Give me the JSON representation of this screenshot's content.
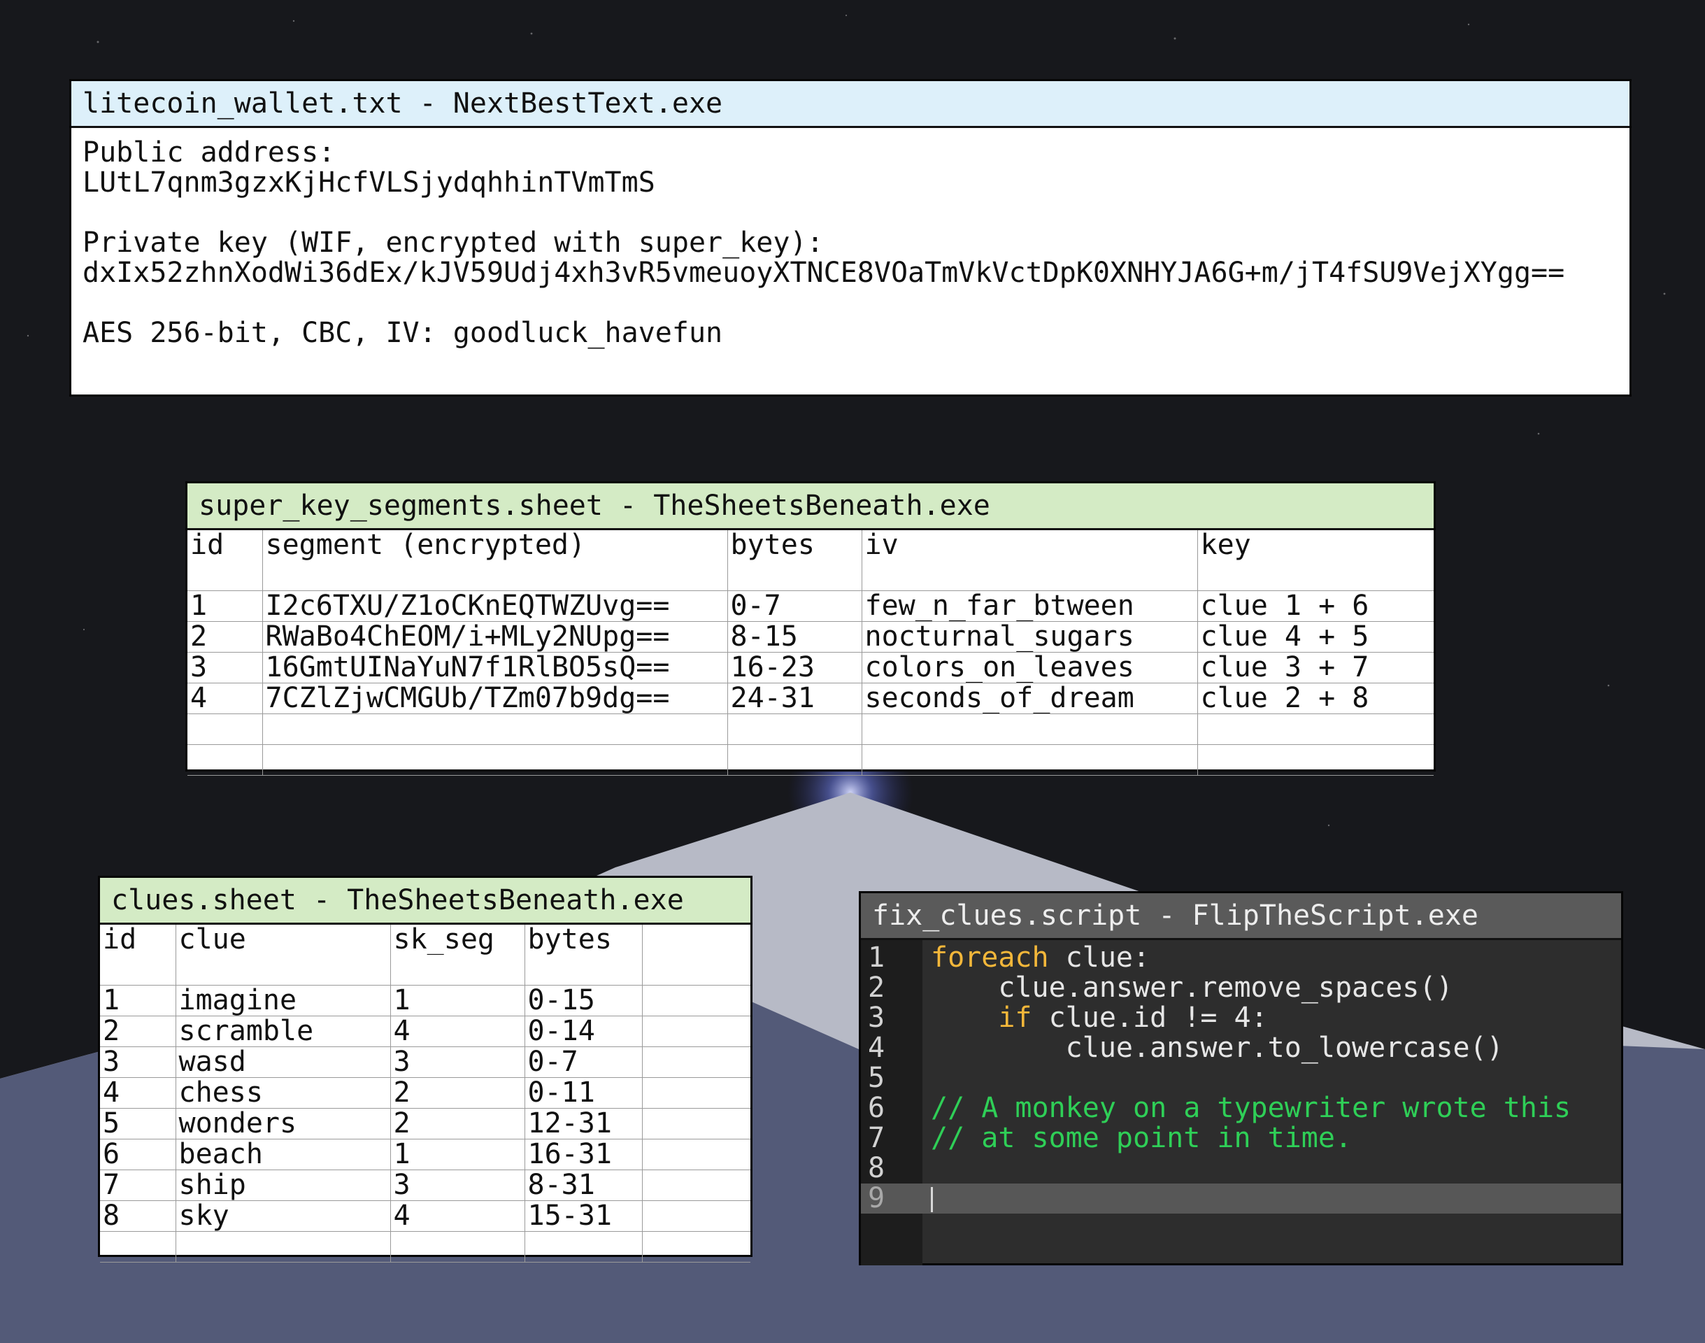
{
  "colors": {
    "background": "#17181c",
    "wallet_title_bg": "#ddf0fa",
    "sheet_title_bg": "#d4ebc5",
    "script_bg": "#2d2d2d",
    "script_keyword": "#f3b73a",
    "script_comment": "#2fcf57",
    "mountain_light": "#b7bac6",
    "mountain_dark": "#535a78"
  },
  "wallet_window": {
    "title": "litecoin_wallet.txt - NextBestText.exe",
    "public_address_label": "Public address:",
    "public_address": "LUtL7qnm3gzxKjHcfVLSjydqhhinTVmTmS",
    "private_key_label": "Private key (WIF, encrypted with super_key):",
    "private_key": "dxIx52zhnXodWi36dEx/kJV59Udj4xh3vR5vmeuoyXTNCE8VOaTmVkVctDpK0XNHYJA6G+m/jT4fSU9VejXYgg==",
    "cipher_note": "AES 256-bit, CBC, IV: goodluck_havefun"
  },
  "segments_window": {
    "title": "super_key_segments.sheet - TheSheetsBeneath.exe",
    "headers": [
      "id",
      "segment (encrypted)",
      "bytes",
      "iv",
      "key"
    ],
    "rows": [
      [
        "1",
        "I2c6TXU/Z1oCKnEQTWZUvg==",
        "0-7",
        "few_n_far_btween",
        "clue 1 + 6"
      ],
      [
        "2",
        "RWaBo4ChEOM/i+MLy2NUpg==",
        "8-15",
        "nocturnal_sugars",
        "clue 4 + 5"
      ],
      [
        "3",
        "16GmtUINaYuN7f1RlBO5sQ==",
        "16-23",
        "colors_on_leaves",
        "clue 3 + 7"
      ],
      [
        "4",
        "7CZlZjwCMGUb/TZm07b9dg==",
        "24-31",
        "seconds_of_dream",
        "clue 2 + 8"
      ]
    ]
  },
  "clues_window": {
    "title": "clues.sheet - TheSheetsBeneath.exe",
    "headers": [
      "id",
      "clue",
      "sk_seg",
      "bytes",
      ""
    ],
    "rows": [
      [
        "1",
        "imagine",
        "1",
        "0-15"
      ],
      [
        "2",
        "scramble",
        "4",
        "0-14"
      ],
      [
        "3",
        "wasd",
        "3",
        "0-7"
      ],
      [
        "4",
        "chess",
        "2",
        "0-11"
      ],
      [
        "5",
        "wonders",
        "2",
        "12-31"
      ],
      [
        "6",
        "beach",
        "1",
        "16-31"
      ],
      [
        "7",
        "ship",
        "3",
        "8-31"
      ],
      [
        "8",
        "sky",
        "4",
        "15-31"
      ]
    ]
  },
  "script_window": {
    "title": "fix_clues.script - FlipTheScript.exe",
    "lines": [
      {
        "num": "1",
        "indent": "",
        "keyword": "foreach",
        "text": " clue:",
        "comment": ""
      },
      {
        "num": "2",
        "indent": "    ",
        "keyword": "",
        "text": "clue.answer.remove_spaces()",
        "comment": ""
      },
      {
        "num": "3",
        "indent": "    ",
        "keyword": "if",
        "text": " clue.id != 4:",
        "comment": ""
      },
      {
        "num": "4",
        "indent": "        ",
        "keyword": "",
        "text": "clue.answer.to_lowercase()",
        "comment": ""
      },
      {
        "num": "5",
        "indent": "",
        "keyword": "",
        "text": "",
        "comment": ""
      },
      {
        "num": "6",
        "indent": "",
        "keyword": "",
        "text": "",
        "comment": "// A monkey on a typewriter wrote this"
      },
      {
        "num": "7",
        "indent": "",
        "keyword": "",
        "text": "",
        "comment": "// at some point in time."
      },
      {
        "num": "8",
        "indent": "",
        "keyword": "",
        "text": "",
        "comment": ""
      },
      {
        "num": "9",
        "indent": "",
        "keyword": "",
        "text": "",
        "comment": ""
      }
    ],
    "active_line": "9"
  }
}
